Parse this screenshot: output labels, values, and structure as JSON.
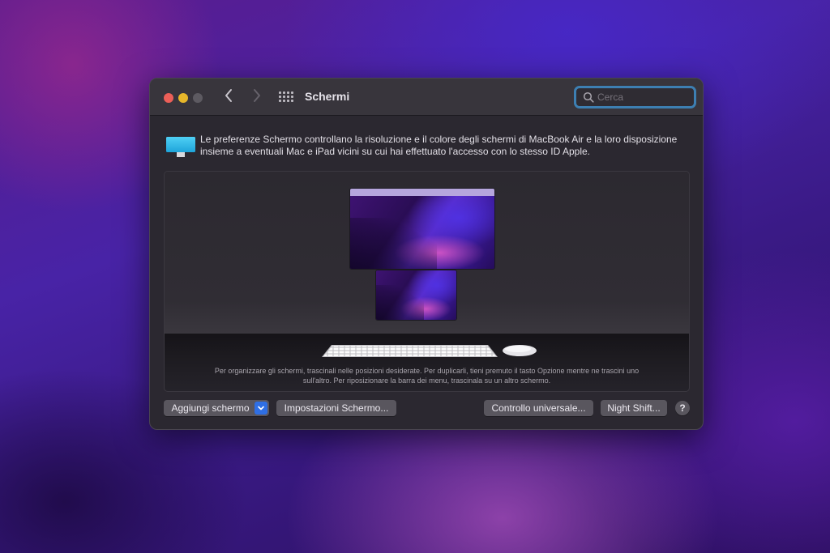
{
  "window": {
    "title": "Schermi",
    "traffic_lights": {
      "close_color": "#ec5f58",
      "minimize_color": "#e6b62a",
      "maximize_color": "#5d5a61"
    },
    "nav": {
      "back_icon": "chevron-left-icon",
      "forward_icon": "chevron-right-icon",
      "grid_icon": "show-all-grid-icon"
    },
    "search": {
      "placeholder": "Cerca",
      "value": "",
      "focus_color": "#3d7fb2"
    }
  },
  "info": {
    "icon": "display-icon",
    "icon_color": "#2fb8e8",
    "text": "Le preferenze Schermo controllano la risoluzione e il colore degli schermi di MacBook Air e la loro disposizione insieme a eventuali Mac e iPad vicini su cui hai effettuato l'accesso con lo stesso ID Apple."
  },
  "arrangement": {
    "displays": [
      {
        "name": "main-display",
        "has_menu_bar": true
      },
      {
        "name": "secondary-display",
        "has_menu_bar": false
      }
    ],
    "peripherals": [
      "keyboard-icon",
      "mouse-icon"
    ],
    "hint": "Per organizzare gli schermi, trascinali nelle posizioni desiderate. Per duplicarli, tieni premuto il tasto Opzione mentre ne trascini uno sull'altro. Per riposizionare la barra dei menu, trascinala su un altro schermo."
  },
  "buttons": {
    "add_display": "Aggiungi schermo",
    "display_settings": "Impostazioni Schermo...",
    "universal_control": "Controllo universale...",
    "night_shift": "Night Shift...",
    "help": "?",
    "accent_color": "#2f6fe4"
  }
}
